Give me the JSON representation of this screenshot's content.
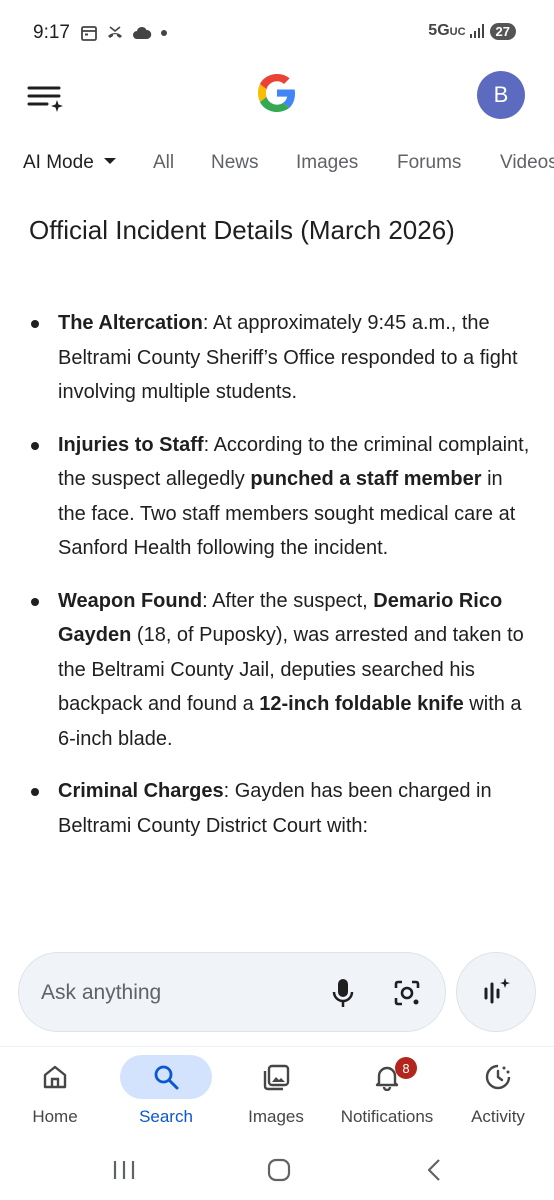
{
  "status_bar": {
    "time": "9:17",
    "network": "5G",
    "network_suffix": "UC",
    "battery": "27"
  },
  "header": {
    "avatar_letter": "B"
  },
  "tabs": [
    {
      "label": "AI Mode",
      "active": true
    },
    {
      "label": "All"
    },
    {
      "label": "News"
    },
    {
      "label": "Images"
    },
    {
      "label": "Forums"
    },
    {
      "label": "Videos"
    }
  ],
  "content": {
    "heading": "Official Incident Details (March 2026)",
    "bullets": [
      {
        "title": "The Altercation",
        "text": ": At approximately 9:45 a.m., the Beltrami County Sheriff’s Office responded to a fight involving multiple students."
      },
      {
        "title": "Injuries to Staff",
        "text1": ": According to the criminal complaint, the suspect allegedly ",
        "bold1": "punched a staff member",
        "text2": " in the face. Two staff members sought medical care at Sanford Health following the incident."
      },
      {
        "title": "Weapon Found",
        "text1": ": After the suspect, ",
        "bold1": "Demario Rico Gayden",
        "text2": " (18, of Puposky), was arrested and taken to the Beltrami County Jail, deputies searched his backpack and found a ",
        "bold2": "12-inch foldable knife",
        "text3": " with a 6-inch blade."
      },
      {
        "title": "Criminal Charges",
        "text": ": Gayden has been charged in Beltrami County District Court with:"
      }
    ]
  },
  "ask_bar": {
    "placeholder": "Ask anything"
  },
  "bottom_nav": {
    "items": [
      {
        "label": "Home",
        "icon": "home-icon"
      },
      {
        "label": "Search",
        "icon": "search-icon",
        "active": true
      },
      {
        "label": "Images",
        "icon": "images-icon"
      },
      {
        "label": "Notifications",
        "icon": "bell-icon",
        "badge": "8"
      },
      {
        "label": "Activity",
        "icon": "activity-icon"
      }
    ]
  },
  "colors": {
    "accent": "#0b57d0",
    "active_pill": "#d3e3fd",
    "avatar": "#5c6bc0",
    "badge": "#b3261e"
  }
}
